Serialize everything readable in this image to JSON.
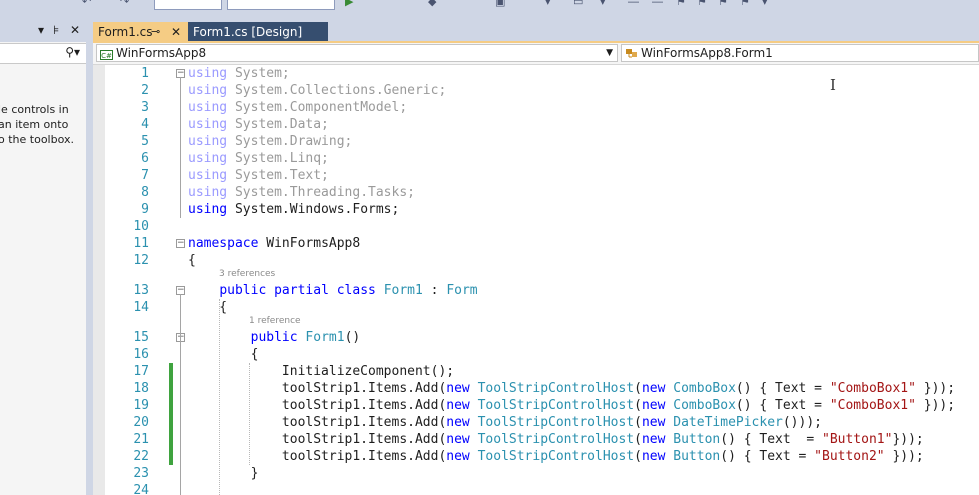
{
  "toolbox": {
    "message_lines": [
      "le controls in",
      "an item onto",
      "o the toolbox."
    ]
  },
  "tabs": [
    {
      "label": "Form1.cs",
      "active": true
    },
    {
      "label": "Form1.cs [Design]",
      "active": false
    }
  ],
  "navbar": {
    "project_combo": "WinFormsApp8",
    "type_combo": "WinFormsApp8.Form1",
    "project_icon": "C#"
  },
  "editor": {
    "lines": [
      {
        "n": "1",
        "tokens": [
          [
            "dk",
            "using"
          ],
          [
            "d",
            " System;"
          ]
        ]
      },
      {
        "n": "2",
        "tokens": [
          [
            "dk",
            "using"
          ],
          [
            "d",
            " System.Collections.Generic;"
          ]
        ]
      },
      {
        "n": "3",
        "tokens": [
          [
            "dk",
            "using"
          ],
          [
            "d",
            " System.ComponentModel;"
          ]
        ]
      },
      {
        "n": "4",
        "tokens": [
          [
            "dk",
            "using"
          ],
          [
            "d",
            " System.Data;"
          ]
        ]
      },
      {
        "n": "5",
        "tokens": [
          [
            "dk",
            "using"
          ],
          [
            "d",
            " System.Drawing;"
          ]
        ]
      },
      {
        "n": "6",
        "tokens": [
          [
            "dk",
            "using"
          ],
          [
            "d",
            " System.Linq;"
          ]
        ]
      },
      {
        "n": "7",
        "tokens": [
          [
            "dk",
            "using"
          ],
          [
            "d",
            " System.Text;"
          ]
        ]
      },
      {
        "n": "8",
        "tokens": [
          [
            "dk",
            "using"
          ],
          [
            "d",
            " System.Threading.Tasks;"
          ]
        ]
      },
      {
        "n": "9",
        "tokens": [
          [
            "k",
            "using"
          ],
          [
            "p",
            " System.Windows.Forms;"
          ]
        ]
      },
      {
        "n": "10",
        "tokens": []
      },
      {
        "n": "11",
        "tokens": [
          [
            "k",
            "namespace"
          ],
          [
            "p",
            " WinFormsApp8"
          ]
        ]
      },
      {
        "n": "12",
        "tokens": [
          [
            "p",
            "{"
          ]
        ]
      },
      {
        "n": "13",
        "tokens": [
          [
            "p",
            "    "
          ],
          [
            "k",
            "public"
          ],
          [
            "p",
            " "
          ],
          [
            "k",
            "partial"
          ],
          [
            "p",
            " "
          ],
          [
            "k",
            "class"
          ],
          [
            "p",
            " "
          ],
          [
            "t",
            "Form1"
          ],
          [
            "p",
            " : "
          ],
          [
            "t",
            "Form"
          ]
        ]
      },
      {
        "n": "14",
        "tokens": [
          [
            "p",
            "    {"
          ]
        ]
      },
      {
        "n": "15",
        "tokens": [
          [
            "p",
            "        "
          ],
          [
            "k",
            "public"
          ],
          [
            "p",
            " "
          ],
          [
            "t",
            "Form1"
          ],
          [
            "p",
            "()"
          ]
        ]
      },
      {
        "n": "16",
        "tokens": [
          [
            "p",
            "        {"
          ]
        ]
      },
      {
        "n": "17",
        "tokens": [
          [
            "p",
            "            InitializeComponent();"
          ]
        ]
      },
      {
        "n": "18",
        "tokens": [
          [
            "p",
            "            toolStrip1.Items.Add("
          ],
          [
            "k",
            "new"
          ],
          [
            "p",
            " "
          ],
          [
            "t",
            "ToolStripControlHost"
          ],
          [
            "p",
            "("
          ],
          [
            "k",
            "new"
          ],
          [
            "p",
            " "
          ],
          [
            "t",
            "ComboBox"
          ],
          [
            "p",
            "() { Text = "
          ],
          [
            "s",
            "\"ComboBox1\""
          ],
          [
            "p",
            " }));"
          ]
        ]
      },
      {
        "n": "19",
        "tokens": [
          [
            "p",
            "            toolStrip1.Items.Add("
          ],
          [
            "k",
            "new"
          ],
          [
            "p",
            " "
          ],
          [
            "t",
            "ToolStripControlHost"
          ],
          [
            "p",
            "("
          ],
          [
            "k",
            "new"
          ],
          [
            "p",
            " "
          ],
          [
            "t",
            "ComboBox"
          ],
          [
            "p",
            "() { Text = "
          ],
          [
            "s",
            "\"ComboBox1\""
          ],
          [
            "p",
            " }));"
          ]
        ]
      },
      {
        "n": "20",
        "tokens": [
          [
            "p",
            "            toolStrip1.Items.Add("
          ],
          [
            "k",
            "new"
          ],
          [
            "p",
            " "
          ],
          [
            "t",
            "ToolStripControlHost"
          ],
          [
            "p",
            "("
          ],
          [
            "k",
            "new"
          ],
          [
            "p",
            " "
          ],
          [
            "t",
            "DateTimePicker"
          ],
          [
            "p",
            "()));"
          ]
        ]
      },
      {
        "n": "21",
        "tokens": [
          [
            "p",
            "            toolStrip1.Items.Add("
          ],
          [
            "k",
            "new"
          ],
          [
            "p",
            " "
          ],
          [
            "t",
            "ToolStripControlHost"
          ],
          [
            "p",
            "("
          ],
          [
            "k",
            "new"
          ],
          [
            "p",
            " "
          ],
          [
            "t",
            "Button"
          ],
          [
            "p",
            "() { Text  = "
          ],
          [
            "s",
            "\"Button1\""
          ],
          [
            "p",
            "}));"
          ]
        ]
      },
      {
        "n": "22",
        "tokens": [
          [
            "p",
            "            toolStrip1.Items.Add("
          ],
          [
            "k",
            "new"
          ],
          [
            "p",
            " "
          ],
          [
            "t",
            "ToolStripControlHost"
          ],
          [
            "p",
            "("
          ],
          [
            "k",
            "new"
          ],
          [
            "p",
            " "
          ],
          [
            "t",
            "Button"
          ],
          [
            "p",
            "() { Text = "
          ],
          [
            "s",
            "\"Button2\""
          ],
          [
            "p",
            " }));"
          ]
        ]
      },
      {
        "n": "23",
        "tokens": [
          [
            "p",
            "        }"
          ]
        ]
      },
      {
        "n": "24",
        "tokens": []
      }
    ],
    "codelens": {
      "class": "3 references",
      "ctor": "1 reference"
    }
  },
  "colors": {
    "keyword": "#0000ff",
    "type": "#2b91af",
    "string": "#a31515",
    "linenumber": "#2b91af",
    "active_tab": "#f5cc84",
    "change_bar": "#3fa33f"
  }
}
